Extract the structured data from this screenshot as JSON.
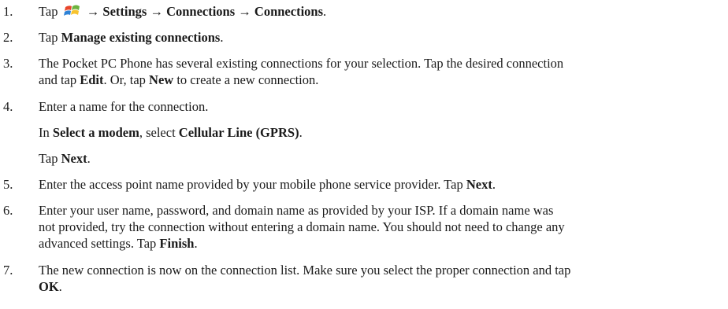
{
  "steps": [
    {
      "number": "1.",
      "lines": [
        {
          "p1": "Tap ",
          "icon": "windows-start-icon",
          "p2": " → ",
          "b1": "Settings",
          "p3": " → ",
          "b2": "Connections",
          "p4": " → ",
          "b3": "Connections",
          "p5": "."
        }
      ]
    },
    {
      "number": "2.",
      "lines": [
        {
          "p1": "Tap ",
          "b1": "Manage existing connections",
          "p2": "."
        }
      ]
    },
    {
      "number": "3.",
      "lines": [
        {
          "p1": "The Pocket PC Phone has several existing connections for your selection. Tap the desired connection"
        },
        {
          "p1": "and tap ",
          "b1": "Edit",
          "p2": ". Or, tap ",
          "b2": "New",
          "p3": " to create a new connection."
        }
      ]
    },
    {
      "number": "4.",
      "lines": [
        {
          "p1": "Enter a name for the connection."
        },
        {
          "p1": "In ",
          "b1": "Select a modem",
          "p2": ", select ",
          "b2": "Cellular Line (GPRS)",
          "p3": "."
        },
        {
          "p1": "Tap ",
          "b1": "Next",
          "p2": "."
        }
      ]
    },
    {
      "number": "5.",
      "lines": [
        {
          "p1": "Enter the access point name provided by your mobile phone service provider. Tap ",
          "b1": "Next",
          "p2": "."
        }
      ]
    },
    {
      "number": "6.",
      "lines": [
        {
          "p1": "Enter your user name, password, and domain name as provided by your ISP. If a domain name was"
        },
        {
          "p1": "not provided, try the connection without entering a domain name. You should not need to change any"
        },
        {
          "p1": "advanced settings. Tap ",
          "b1": "Finish",
          "p2": "."
        }
      ]
    },
    {
      "number": "7.",
      "lines": [
        {
          "p1": "The new connection is now on the connection list. Make sure you select the proper connection and tap"
        },
        {
          "b1": "OK",
          "p1": "."
        }
      ]
    }
  ]
}
